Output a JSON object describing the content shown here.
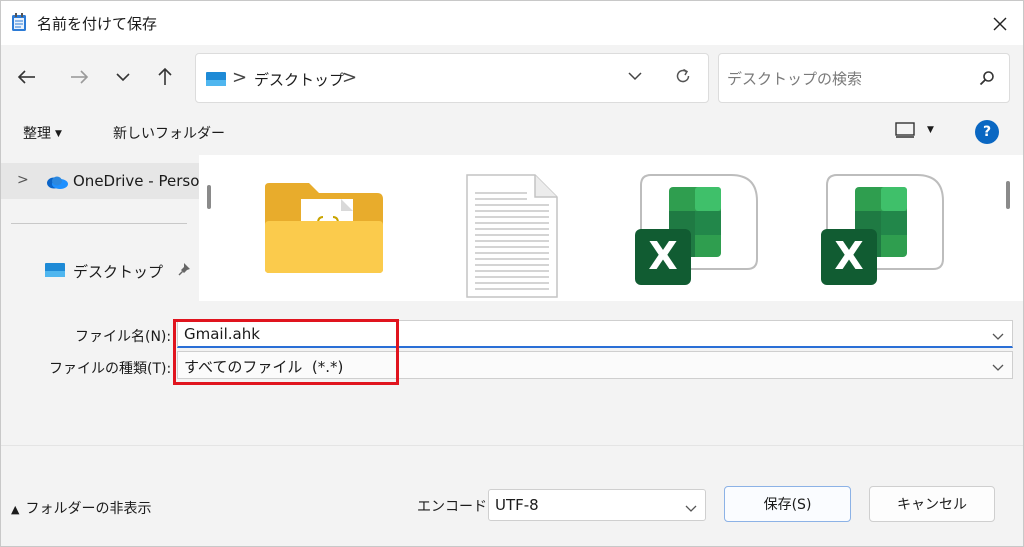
{
  "window": {
    "title": "名前を付けて保存"
  },
  "address": {
    "crumb": "デスクトップ",
    "separator": ">"
  },
  "search": {
    "placeholder": "デスクトップの検索"
  },
  "toolbar": {
    "organize_label": "整理",
    "new_folder_label": "新しいフォルダー",
    "help_label": "?"
  },
  "navpane": {
    "items": [
      {
        "label": "OneDrive - Personal",
        "expand": ">"
      },
      {
        "label": "デスクトップ"
      }
    ]
  },
  "files": [
    {
      "icon": "folder-icon"
    },
    {
      "icon": "text-document-icon"
    },
    {
      "icon": "excel-file-icon"
    },
    {
      "icon": "excel-file-icon"
    }
  ],
  "fields": {
    "filename_label": "ファイル名(N):",
    "filename_value": "Gmail.ahk",
    "filetype_label": "ファイルの種類(T):",
    "filetype_value": "すべてのファイル  (*.*)"
  },
  "footer": {
    "hide_folders_label": "フォルダーの非表示",
    "encoding_label": "エンコード:",
    "encoding_value": "UTF-8",
    "save_label": "保存(S)",
    "cancel_label": "キャンセル"
  },
  "colors": {
    "accent": "#0a67c2",
    "highlight": "#e0141e",
    "excel_green": "#1d6f42"
  }
}
